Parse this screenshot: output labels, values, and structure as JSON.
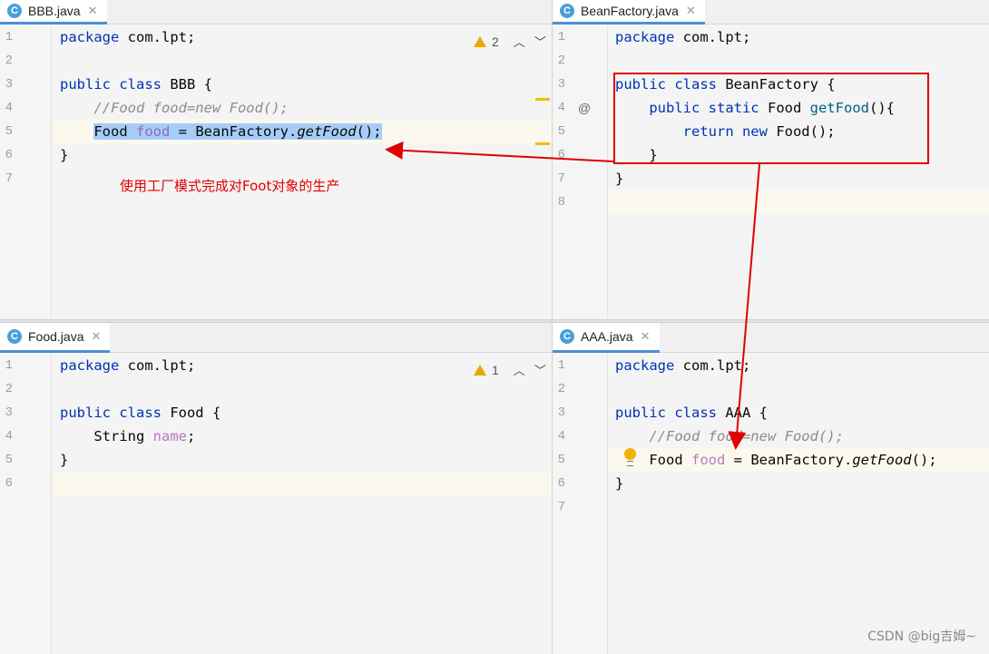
{
  "panes": {
    "top_left": {
      "tab": {
        "label": "BBB.java",
        "icon": "C"
      },
      "inspection": {
        "warnings": "2"
      },
      "lines": [
        {
          "num": "1",
          "text": "package com.lpt;"
        },
        {
          "num": "2",
          "text": ""
        },
        {
          "num": "3",
          "text": "public class BBB {"
        },
        {
          "num": "4",
          "text": "    //Food food=new Food();"
        },
        {
          "num": "5",
          "text": "    Food food = BeanFactory.getFood();"
        },
        {
          "num": "6",
          "text": "}"
        },
        {
          "num": "7",
          "text": ""
        }
      ]
    },
    "top_right": {
      "tab": {
        "label": "BeanFactory.java",
        "icon": "C"
      },
      "lines": [
        {
          "num": "1",
          "text": "package com.lpt;"
        },
        {
          "num": "2",
          "text": ""
        },
        {
          "num": "3",
          "text": "public class BeanFactory {"
        },
        {
          "num": "4",
          "text": "    public static Food getFood(){"
        },
        {
          "num": "5",
          "text": "        return new Food();"
        },
        {
          "num": "6",
          "text": "    }"
        },
        {
          "num": "7",
          "text": "}"
        },
        {
          "num": "8",
          "text": ""
        }
      ],
      "gutter_marker": "@"
    },
    "bottom_left": {
      "tab": {
        "label": "Food.java",
        "icon": "C"
      },
      "inspection": {
        "warnings": "1"
      },
      "lines": [
        {
          "num": "1",
          "text": "package com.lpt;"
        },
        {
          "num": "2",
          "text": ""
        },
        {
          "num": "3",
          "text": "public class Food {"
        },
        {
          "num": "4",
          "text": "    String name;"
        },
        {
          "num": "5",
          "text": "}"
        },
        {
          "num": "6",
          "text": ""
        }
      ]
    },
    "bottom_right": {
      "tab": {
        "label": "AAA.java",
        "icon": "C"
      },
      "lines": [
        {
          "num": "1",
          "text": "package com.lpt;"
        },
        {
          "num": "2",
          "text": ""
        },
        {
          "num": "3",
          "text": "public class AAA {"
        },
        {
          "num": "4",
          "text": "    //Food food=new Food();"
        },
        {
          "num": "5",
          "text": "    Food food = BeanFactory.getFood();"
        },
        {
          "num": "6",
          "text": "}"
        },
        {
          "num": "7",
          "text": ""
        }
      ]
    }
  },
  "annotation": "使用工厂模式完成对Foot对象的生产",
  "watermark": "CSDN @big吉姆~",
  "colors": {
    "keyword": "#0033b3",
    "comment": "#8c8c8c",
    "method": "#00627a",
    "annotation_red": "#e00000",
    "selection": "#a6cdf7"
  }
}
